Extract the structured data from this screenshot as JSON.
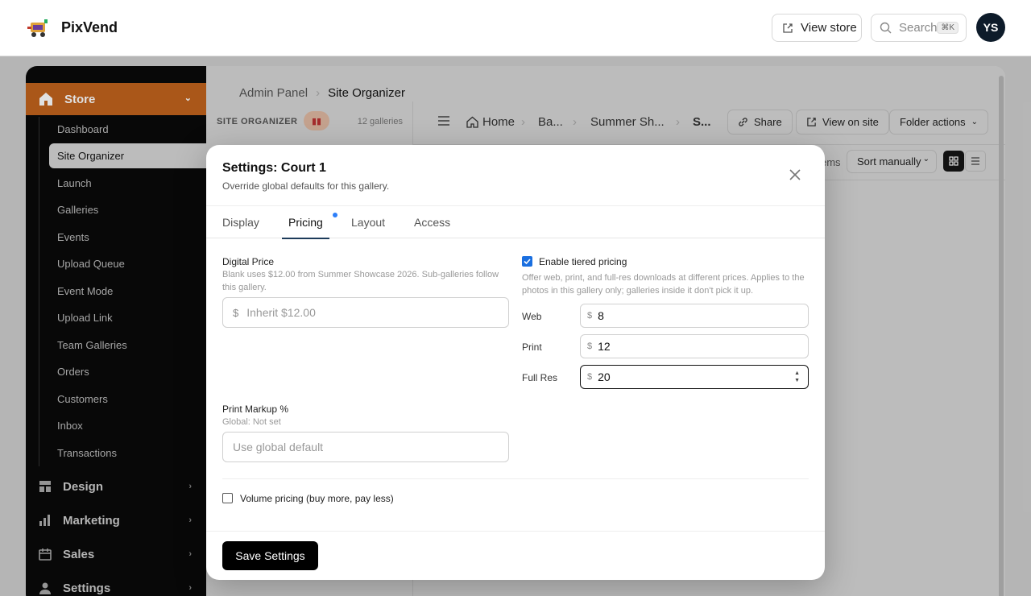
{
  "header": {
    "brand": "PixVend",
    "view_store": "View store",
    "search_placeholder": "Search",
    "search_kbd": "⌘K",
    "avatar_initials": "YS"
  },
  "sidebar": {
    "store_label": "Store",
    "items": [
      "Dashboard",
      "Site Organizer",
      "Launch",
      "Galleries",
      "Events",
      "Upload Queue",
      "Event Mode",
      "Upload Link",
      "Team Galleries",
      "Orders",
      "Customers",
      "Inbox",
      "Transactions"
    ],
    "active_item": "Site Organizer",
    "groups": [
      "Design",
      "Marketing",
      "Sales",
      "Settings"
    ]
  },
  "breadcrumb": {
    "parent": "Admin Panel",
    "current": "Site Organizer"
  },
  "site_organizer": {
    "title": "SITE ORGANIZER",
    "count": "12 galleries"
  },
  "toolbar": {
    "home": "Home",
    "crumb_2": "Ba...",
    "crumb_3": "Summer Sh...",
    "crumb_4": "S...",
    "share": "Share",
    "view_on_site": "View on site",
    "folder_actions": "Folder actions"
  },
  "sortbar": {
    "items_label": "ems",
    "sort": "Sort manually"
  },
  "modal": {
    "title": "Settings: Court 1",
    "subtitle": "Override global defaults for this gallery.",
    "tabs": [
      "Display",
      "Pricing",
      "Layout",
      "Access"
    ],
    "active_tab": "Pricing",
    "digital_price": {
      "label": "Digital Price",
      "hint": "Blank uses $12.00 from Summer Showcase 2026. Sub-galleries follow this gallery.",
      "currency": "$",
      "placeholder": "Inherit $12.00"
    },
    "print_markup": {
      "label": "Print Markup %",
      "hint": "Global: Not set",
      "placeholder": "Use global default"
    },
    "tiered": {
      "label": "Enable tiered pricing",
      "checked": true,
      "hint": "Offer web, print, and full-res downloads at different prices. Applies to the photos in this gallery only; galleries inside it don't pick it up.",
      "rows": [
        {
          "label": "Web",
          "currency": "$",
          "value": "8"
        },
        {
          "label": "Print",
          "currency": "$",
          "value": "12"
        },
        {
          "label": "Full Res",
          "currency": "$",
          "value": "20"
        }
      ]
    },
    "volume_pricing": {
      "label": "Volume pricing (buy more, pay less)",
      "checked": false
    },
    "save_label": "Save Settings"
  },
  "colors": {
    "accent_orange": "#c2631d",
    "checkbox_blue": "#1a6fe0",
    "tab_dot": "#2d7ff9"
  }
}
